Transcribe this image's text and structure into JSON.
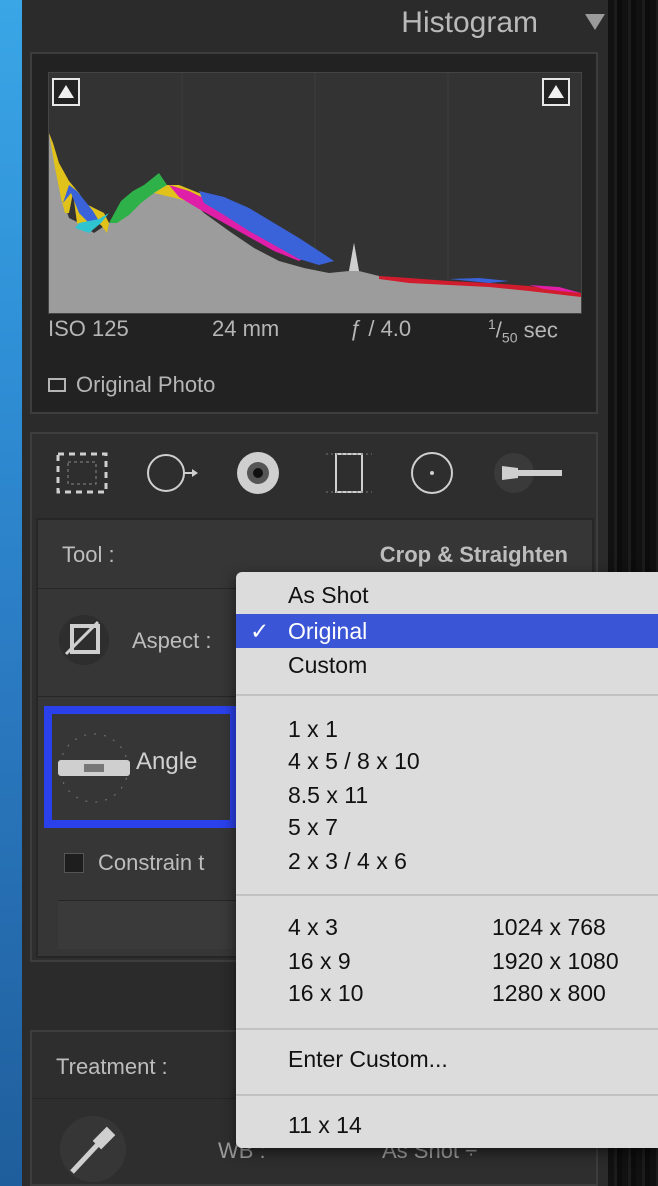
{
  "histogram": {
    "title": "Histogram",
    "exif": {
      "iso": "ISO 125",
      "focal": "24 mm",
      "aperture": "ƒ / 4.0",
      "shutter_num": "1",
      "shutter_den": "50",
      "shutter_unit": " sec"
    },
    "original_photo": "Original Photo"
  },
  "tools": {
    "icons": [
      "crop-icon",
      "spot-removal-icon",
      "red-eye-icon",
      "graduated-filter-icon",
      "radial-filter-icon",
      "adjustment-brush-icon"
    ],
    "tool_label": "Tool :",
    "tool_value": "Crop & Straighten",
    "aspect_label": "Aspect :",
    "angle_label": "Angle",
    "constrain_label": "Constrain t"
  },
  "treatment": {
    "label": "Treatment :",
    "wb_label": "WB :",
    "wb_value": "As Shot ÷"
  },
  "aspect_menu": {
    "selected": "Original",
    "group1": [
      "As Shot",
      "Original",
      "Custom"
    ],
    "group2": [
      "1 x 1",
      "4 x 5  /  8 x 10",
      "8.5 x 11",
      "5 x 7",
      "2 x 3  /  4 x 6"
    ],
    "group3": [
      {
        "label": "4 x 3",
        "res": "1024 x 768"
      },
      {
        "label": "16 x 9",
        "res": "1920 x 1080"
      },
      {
        "label": "16 x 10",
        "res": "1280 x 800"
      }
    ],
    "enter_custom": "Enter Custom...",
    "last": "11 x 14",
    "check_mark": "✓"
  }
}
